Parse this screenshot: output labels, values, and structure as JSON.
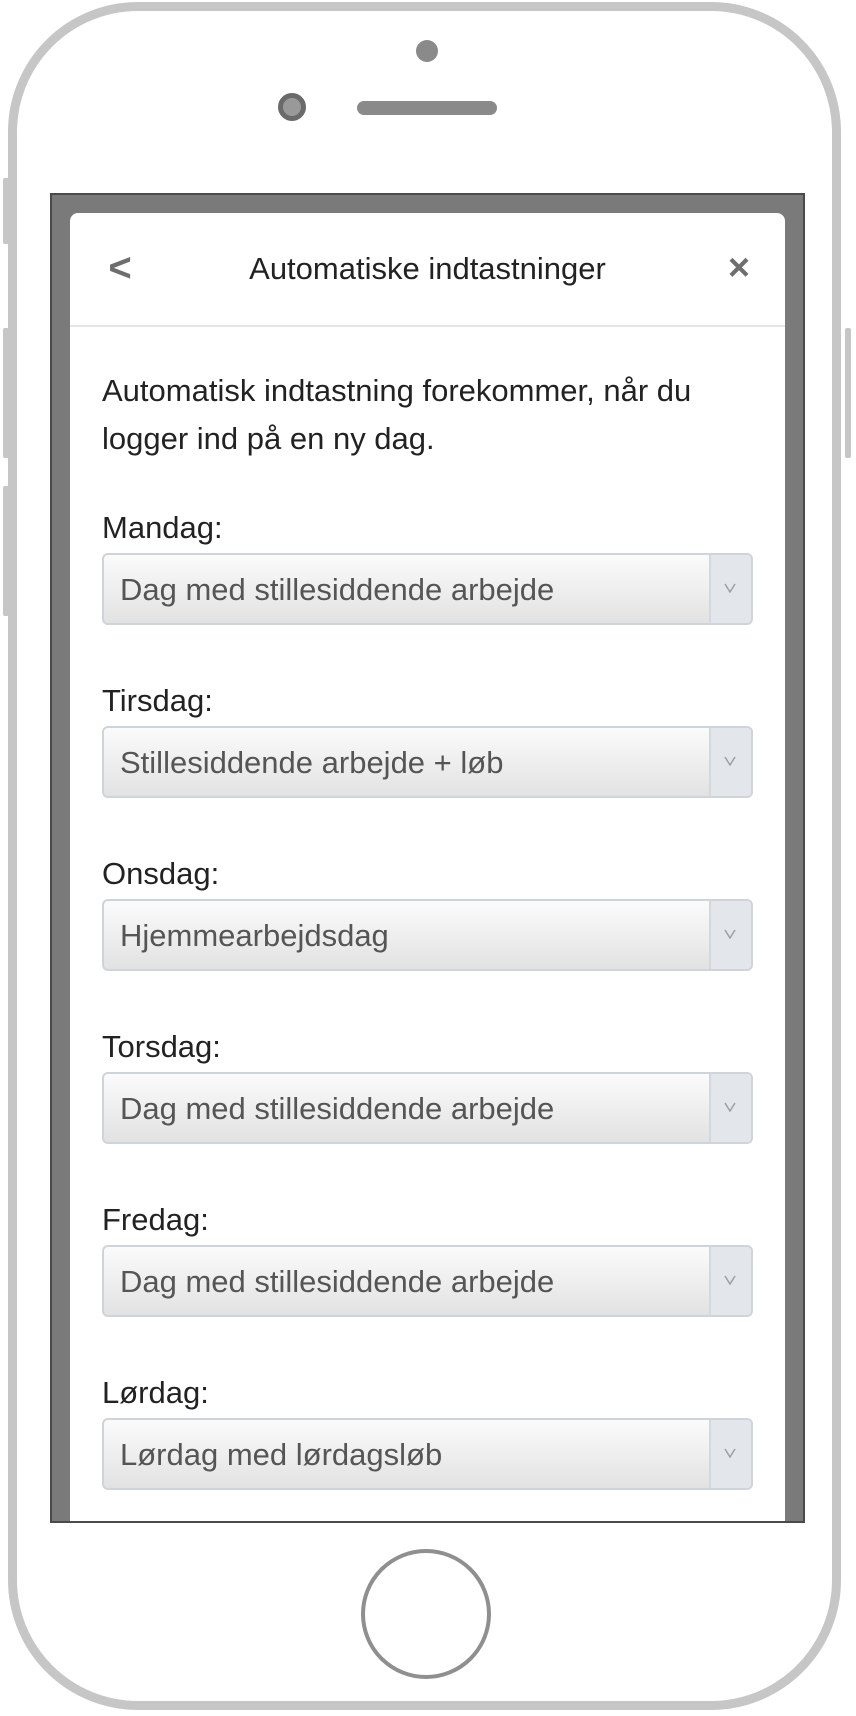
{
  "header": {
    "back_label": "<",
    "title": "Automatiske indtastninger",
    "close_label": "×"
  },
  "intro": "Automatisk indtastning forekommer, når du logger ind på en ny dag.",
  "days": [
    {
      "label": "Mandag:",
      "value": "Dag med stillesiddende arbejde"
    },
    {
      "label": "Tirsdag:",
      "value": "Stillesiddende arbejde + løb"
    },
    {
      "label": "Onsdag:",
      "value": "Hjemmearbejdsdag"
    },
    {
      "label": "Torsdag:",
      "value": "Dag med stillesiddende arbejde"
    },
    {
      "label": "Fredag:",
      "value": "Dag med stillesiddende arbejde"
    },
    {
      "label": "Lørdag:",
      "value": "Lørdag med lørdagsløb"
    }
  ],
  "icons": {
    "dropdown": "chevron-down-icon"
  }
}
